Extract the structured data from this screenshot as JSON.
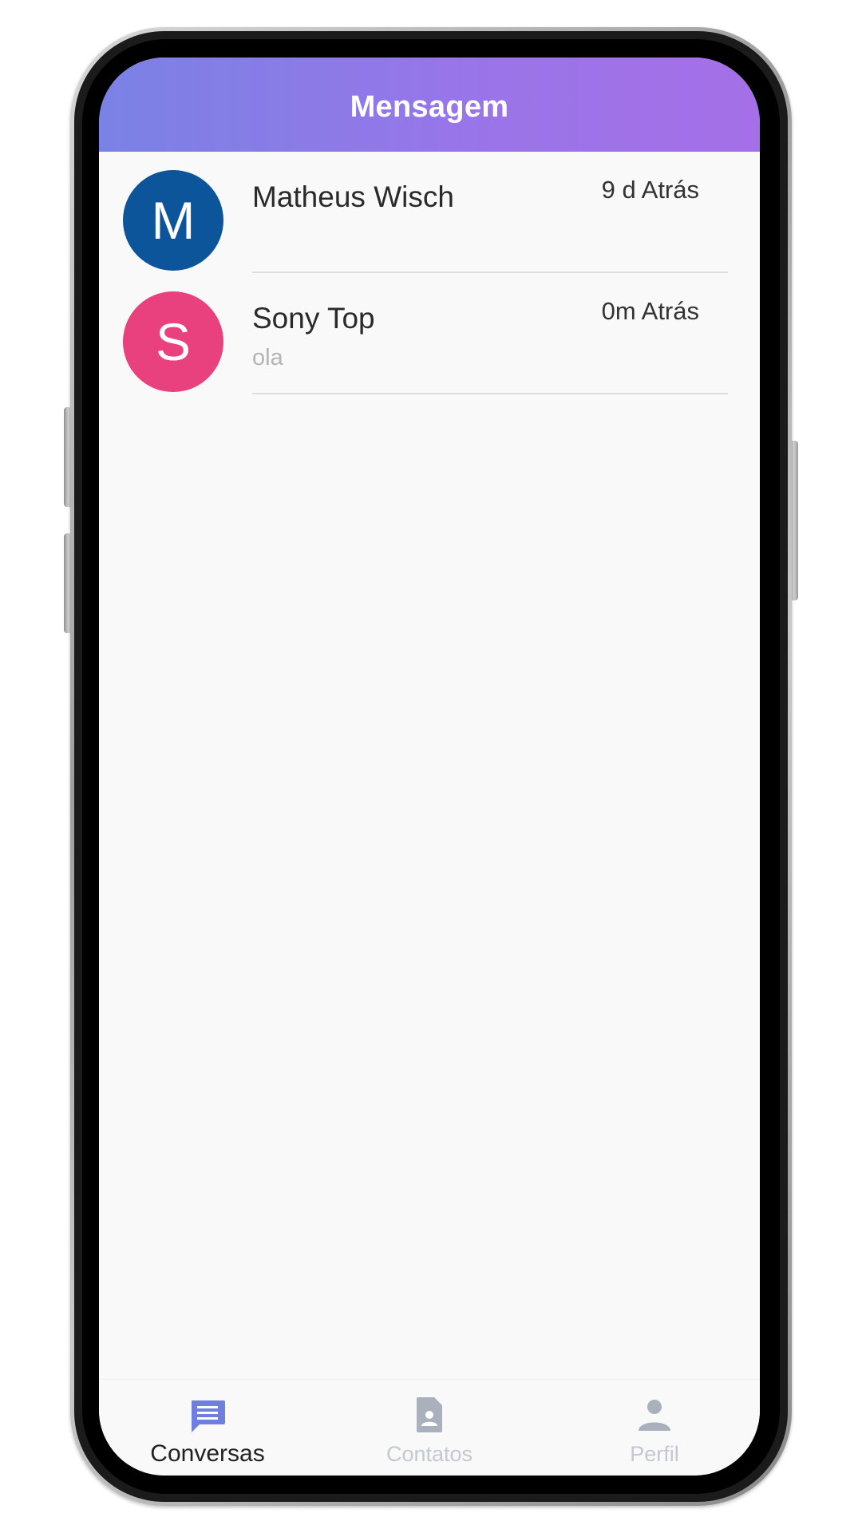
{
  "header": {
    "title": "Mensagem"
  },
  "conversations": [
    {
      "avatar_letter": "M",
      "avatar_color": "#0d559b",
      "name": "Matheus Wisch",
      "time": "9 d Atrás",
      "preview": ""
    },
    {
      "avatar_letter": "S",
      "avatar_color": "#e8417d",
      "name": "Sony Top",
      "time": "0m Atrás",
      "preview": "ola"
    }
  ],
  "tabs": [
    {
      "label": "Conversas",
      "icon": "chat-icon",
      "active": true
    },
    {
      "label": "Contatos",
      "icon": "contact-card-icon",
      "active": false
    },
    {
      "label": "Perfil",
      "icon": "person-icon",
      "active": false
    }
  ],
  "colors": {
    "header_gradient_start": "#7a82e6",
    "header_gradient_end": "#a56fe8",
    "tab_active": "#6f7fdf",
    "tab_inactive": "#aab1bd"
  }
}
